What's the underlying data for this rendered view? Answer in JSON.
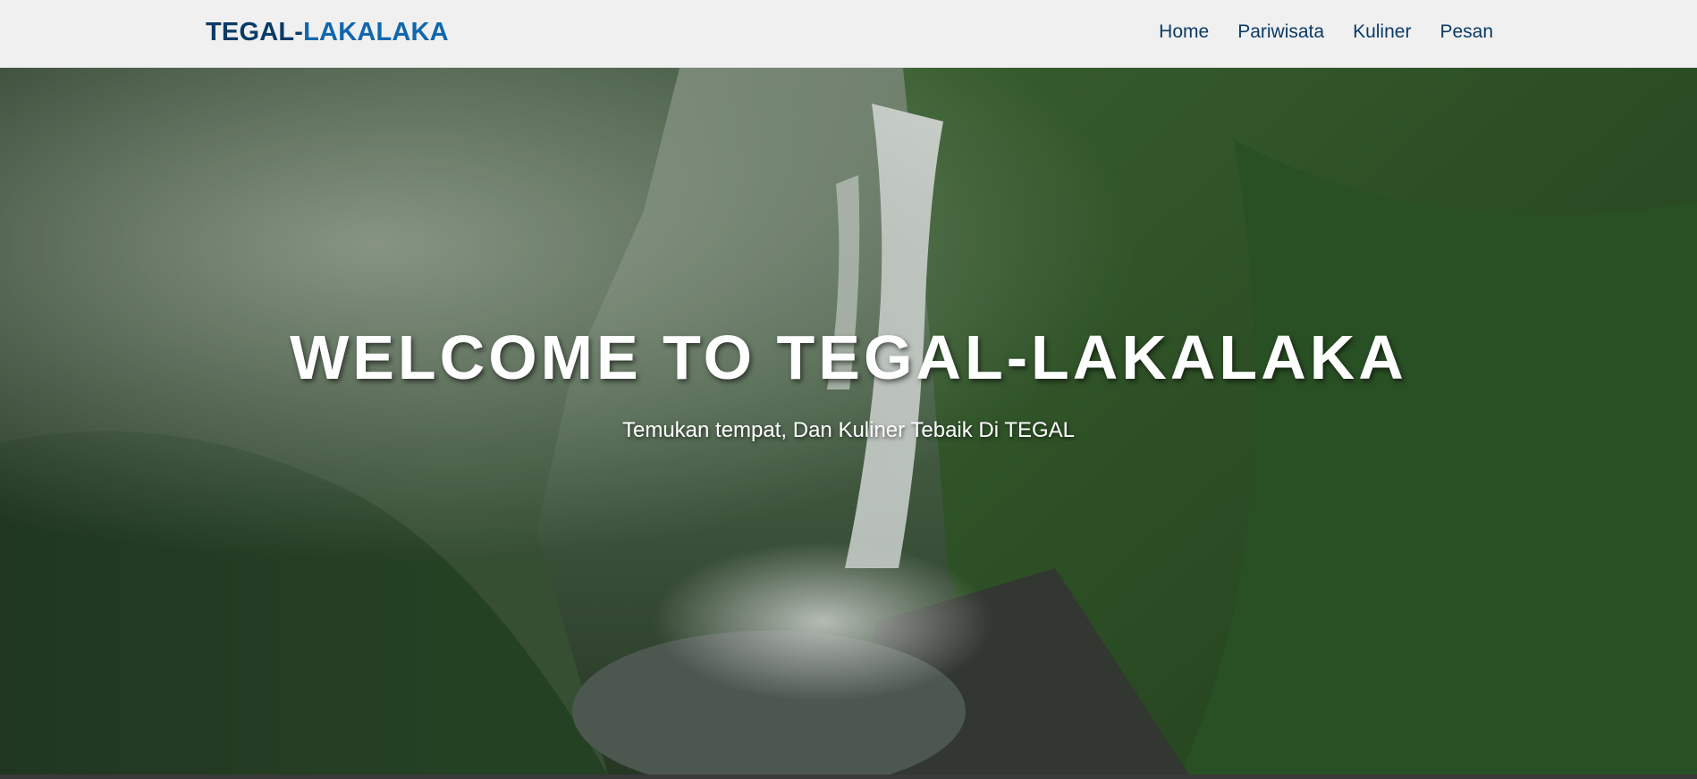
{
  "brand": {
    "part1": "TEGAL",
    "part2": "-",
    "part3": "LAKALAKA"
  },
  "nav": {
    "items": [
      {
        "label": "Home"
      },
      {
        "label": "Pariwisata"
      },
      {
        "label": "Kuliner"
      },
      {
        "label": "Pesan"
      }
    ]
  },
  "hero": {
    "title": "WELCOME TO TEGAL-LAKALAKA",
    "subtitle": "Temukan tempat, Dan Kuliner Tebaik Di TEGAL",
    "background": "waterfall-jungle-photo"
  },
  "colors": {
    "navbar_bg": "#f0f0f0",
    "brand_dark": "#0b3b66",
    "brand_accent": "#1167ad",
    "nav_text": "#0b3b66",
    "hero_text": "#ffffff"
  }
}
